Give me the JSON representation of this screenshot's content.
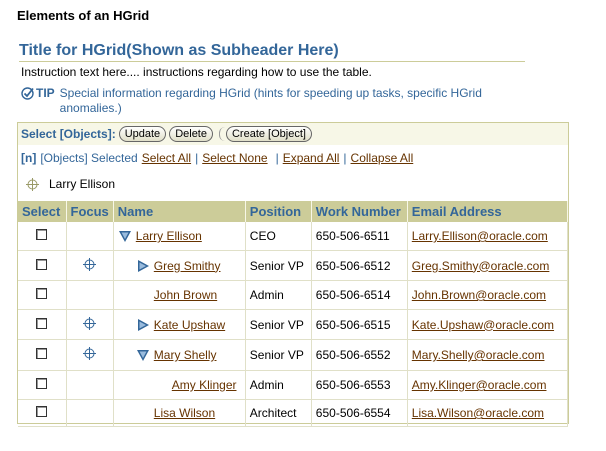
{
  "page_heading": "Elements of an HGrid",
  "subheader": "Title for HGrid(Shown as Subheader Here)",
  "instruction": "Instruction text here.... instructions regarding how to use the table.",
  "tip": {
    "icon": "checkmark-icon",
    "label": "TIP",
    "text": "Special information regarding HGrid (hints for speeding up tasks, specific HGrid anomalies.)"
  },
  "controls": {
    "select_label": "Select [Objects]:",
    "update": "Update",
    "delete": "Delete",
    "create": "Create [Object]"
  },
  "links": {
    "count": "[n]",
    "selected_text": "[Objects] Selected",
    "select_all": "Select All",
    "select_none": "Select None",
    "expand_all": "Expand All",
    "collapse_all": "Collapse All"
  },
  "breadcrumb": {
    "icon": "focus-crosshair-icon",
    "label": "Larry Ellison"
  },
  "columns": [
    "Select",
    "Focus",
    "Name",
    "Position",
    "Work Number",
    "Email Address"
  ],
  "rows": [
    {
      "name": "Larry Ellison",
      "position": "CEO",
      "work": "650-506-6511",
      "email": "Larry.Ellison@oracle.com",
      "level": 0,
      "twisty": "expanded",
      "focus": false
    },
    {
      "name": "Greg Smithy",
      "position": "Senior VP",
      "work": "650-506-6512",
      "email": "Greg.Smithy@oracle.com",
      "level": 1,
      "twisty": "collapsed",
      "focus": true
    },
    {
      "name": "John Brown",
      "position": "Admin",
      "work": "650-506-6514",
      "email": "John.Brown@oracle.com",
      "level": 1,
      "twisty": "none",
      "focus": false
    },
    {
      "name": "Kate Upshaw",
      "position": "Senior VP",
      "work": "650-506-6515",
      "email": "Kate.Upshaw@oracle.com",
      "level": 1,
      "twisty": "collapsed",
      "focus": true
    },
    {
      "name": "Mary Shelly",
      "position": "Senior VP",
      "work": "650-506-6552",
      "email": "Mary.Shelly@oracle.com",
      "level": 1,
      "twisty": "expanded",
      "focus": true
    },
    {
      "name": "Amy Klinger",
      "position": "Admin",
      "work": "650-506-6553",
      "email": "Amy.Klinger@oracle.com",
      "level": 2,
      "twisty": "none",
      "focus": false
    },
    {
      "name": "Lisa Wilson",
      "position": "Architect",
      "work": "650-506-6554",
      "email": "Lisa.Wilson@oracle.com",
      "level": 1,
      "twisty": "none",
      "focus": false
    }
  ],
  "colors": {
    "header_bg": "#cccc99",
    "header_text": "#336699",
    "link": "#663300",
    "twisty": "#336699"
  }
}
